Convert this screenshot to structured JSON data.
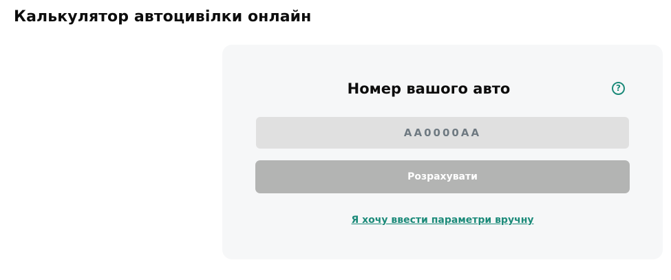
{
  "page": {
    "title": "Калькулятор автоцивілки онлайн"
  },
  "calculator": {
    "heading": "Номер вашого авто",
    "help_icon": "question-circle-icon",
    "plate_input": {
      "value": "",
      "placeholder": "АА0000АА"
    },
    "calculate_label": "Розрахувати",
    "manual_link": "Я хочу ввести параметри вручну"
  },
  "colors": {
    "accent": "#1b8a79",
    "card_background": "#f6f7f8",
    "button_disabled": "#b3b4b3",
    "input_background": "#e0e0e0"
  }
}
